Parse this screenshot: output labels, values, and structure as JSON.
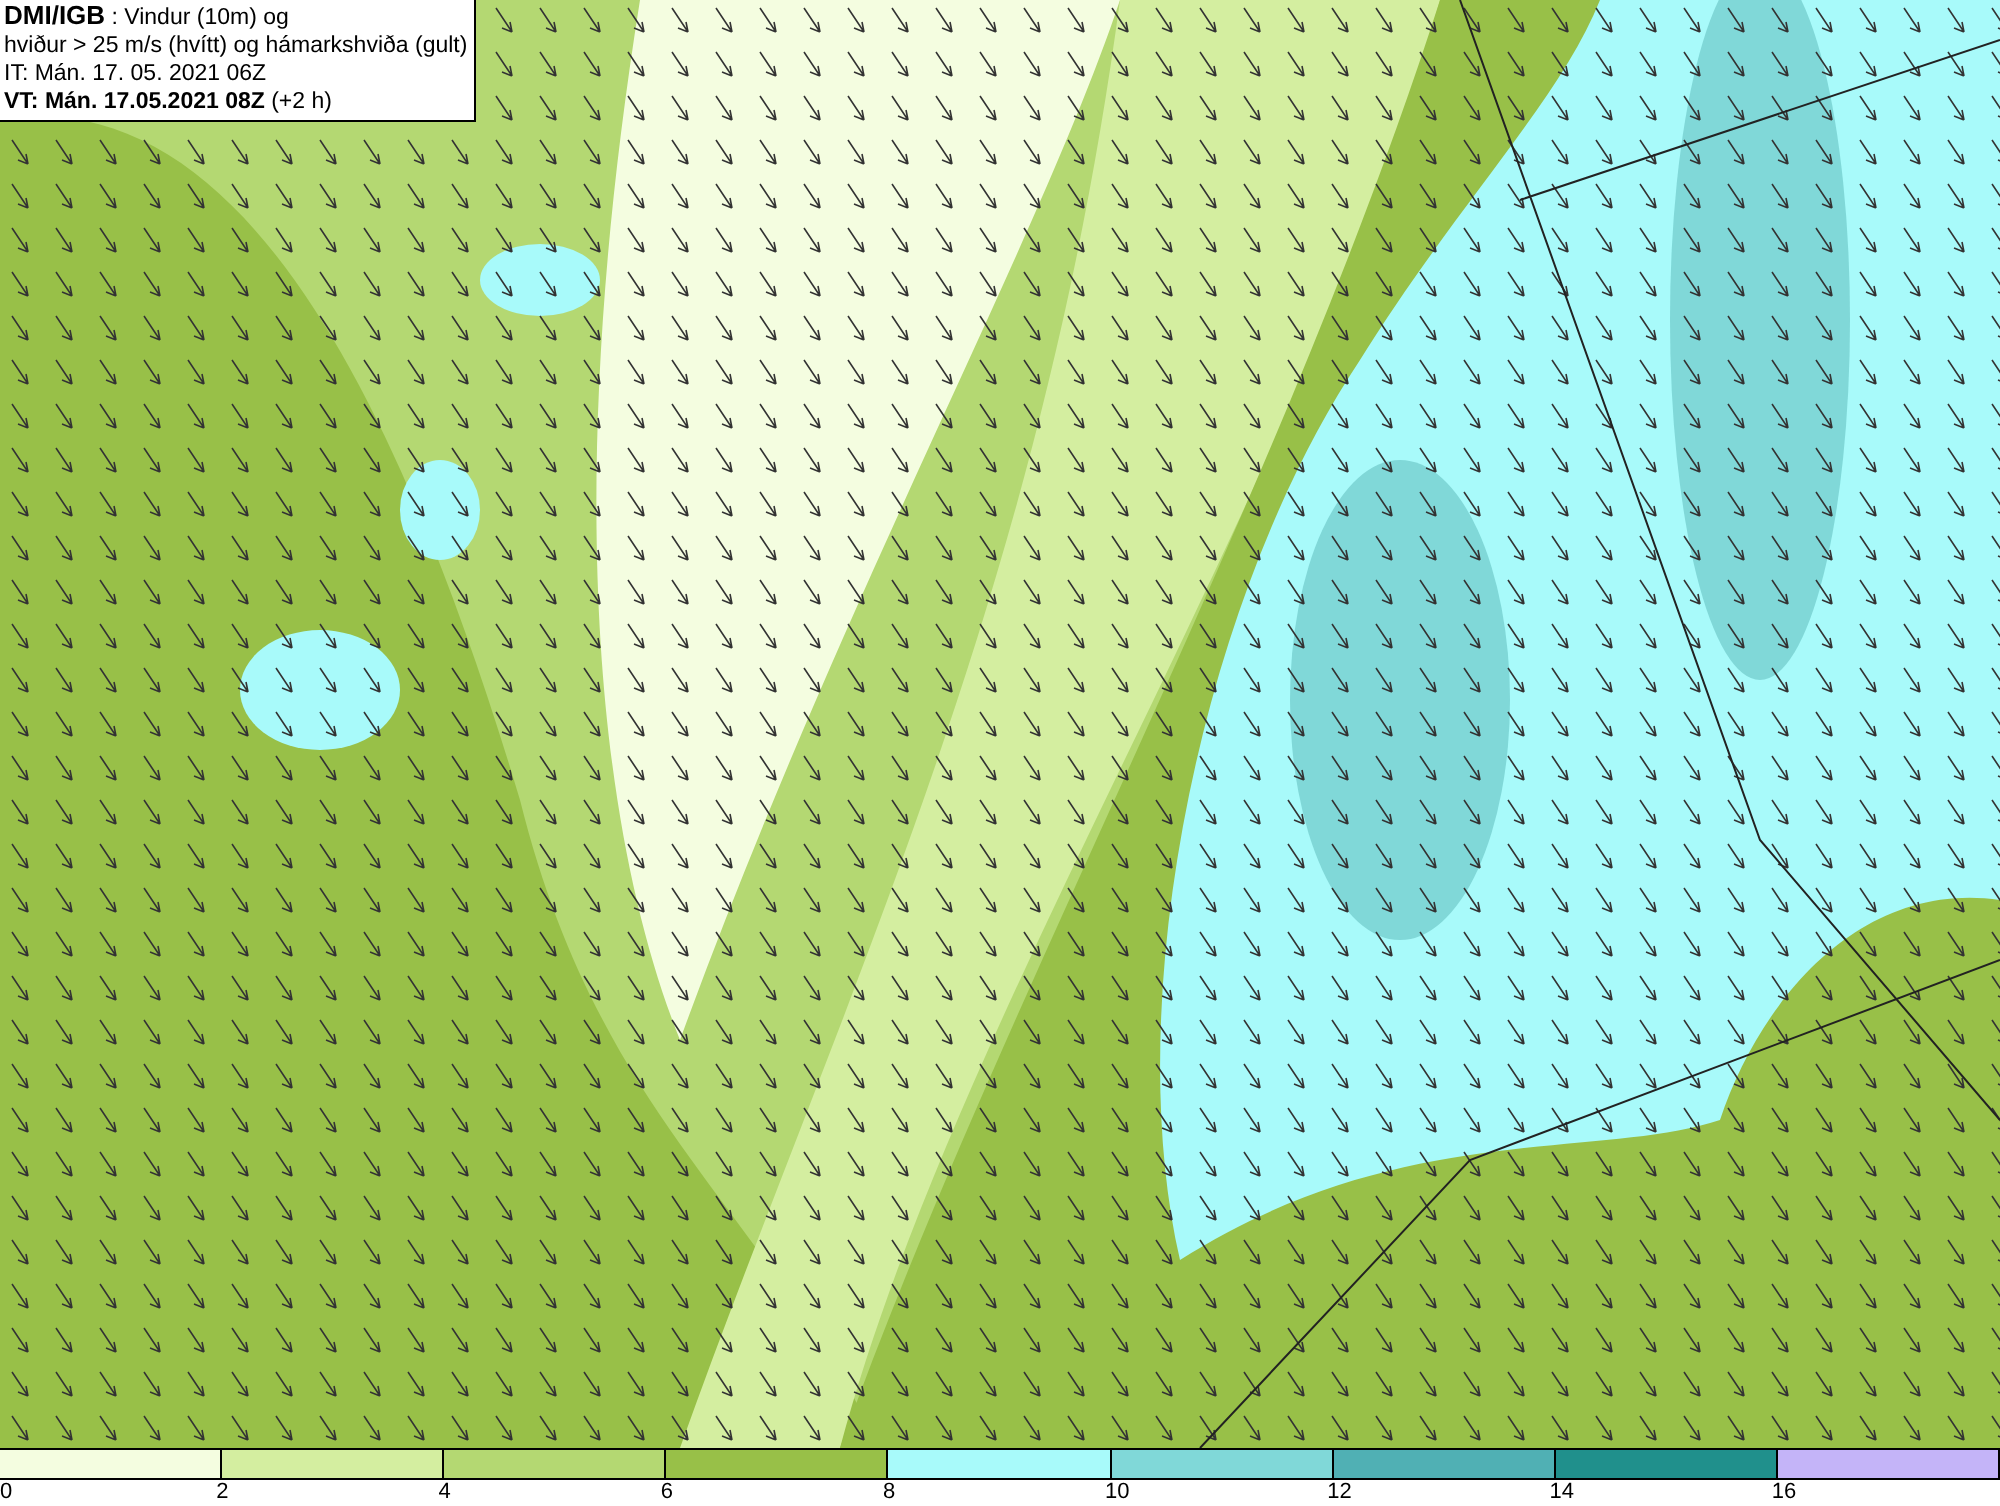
{
  "header": {
    "lines": [
      "**DMI/IGB** : Vindur (10m) og",
      "hviður > 25 m/s (hvítt) og hámarkshviða (gult)",
      "IT: Mán. 17. 05. 2021 06Z",
      "**VT: Mán. 17.05.2021 08Z** (+2 h)"
    ]
  },
  "legend": {
    "swatches": [
      {
        "color": "#f4fde0"
      },
      {
        "color": "#d4eea0"
      },
      {
        "color": "#b4d872"
      },
      {
        "color": "#98c048"
      },
      {
        "color": "#a8fafa"
      },
      {
        "color": "#80d8d8"
      },
      {
        "color": "#50b0b4"
      },
      {
        "color": "#20908c"
      },
      {
        "color": "#c4b4f8"
      }
    ],
    "ticks": [
      "0",
      "2",
      "4",
      "6",
      "8",
      "10",
      "12",
      "14",
      "16"
    ]
  }
}
